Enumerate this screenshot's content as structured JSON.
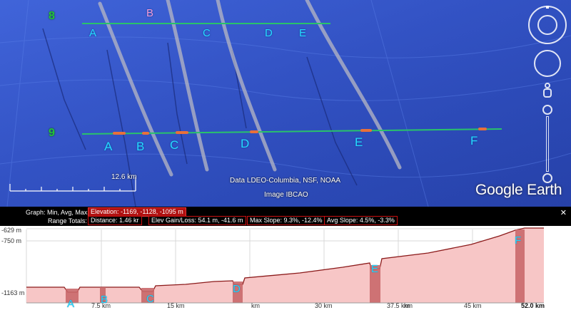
{
  "map": {
    "top_row_number": "8",
    "bottom_row_number": "9",
    "top_labels": {
      "a": "A",
      "b": "B",
      "c": "C",
      "d": "D",
      "e": "E"
    },
    "bottom_labels": {
      "a": "A",
      "b": "B",
      "c": "C",
      "d": "D",
      "e": "E",
      "f": "F"
    },
    "scale_label": "12.6 km",
    "credit_1": "Data LDEO-Columbia, NSF, NOAA",
    "credit_2": "Image IBCAO",
    "logo": "Google Earth",
    "path_color": "#29c36a"
  },
  "elevation_panel": {
    "graph_label": "Graph: Min, Avg, Max:",
    "elevation_stat": "Elevation: -1169, -1128, -1095 m",
    "range_label": "Range Totals:",
    "distance": "Distance: 1.46 kr",
    "elev_gain_loss": "Elev Gain/Loss: 54.1 m, -41.6 m",
    "max_slope": "Max Slope: 9.3%, -12.4%",
    "avg_slope": "Avg Slope: 4.5%, -3.3%",
    "close_icon": "x-icon",
    "y_ticks": [
      "-629 m",
      "-750 m",
      "-1163 m"
    ],
    "x_ticks": [
      "7.5 km",
      "15 km",
      "km",
      "30 km",
      "37.5 km",
      "km",
      "45 km",
      "52.0 km"
    ],
    "profile_labels": {
      "a": "A",
      "b": "B",
      "c": "C",
      "d": "D",
      "e": "E",
      "f": "F"
    },
    "fill_color": "#f7c6c6",
    "line_color": "#8b1a1a"
  }
}
